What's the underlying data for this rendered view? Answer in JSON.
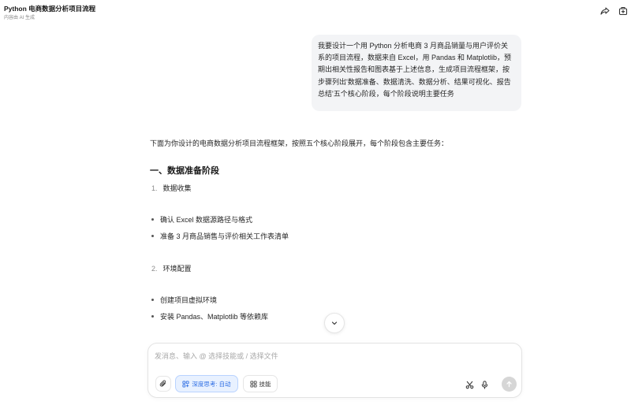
{
  "header": {
    "title": "Python 电商数据分析项目流程",
    "subtitle": "内容由 AI 生成"
  },
  "user_message": "我要设计一个用 Python 分析电商 3 月商品销量与用户评价关系的项目流程，数据来自 Excel，用 Pandas 和 Matplotlib，预期出相关性报告和图表基于上述信息，生成项目流程框架，按步骤列出'数据准备、数据清洗、数据分析、结果可视化、报告总结'五个核心阶段，每个阶段说明主要任务",
  "answer": {
    "intro": "下面为你设计的电商数据分析项目流程框架，按照五个核心阶段展开，每个阶段包含主要任务：",
    "section_title": "一、数据准备阶段",
    "steps": [
      {
        "number": "1.",
        "label": "数据收集",
        "bullets": [
          "确认 Excel 数据源路径与格式",
          "准备 3 月商品销售与评价相关工作表清单"
        ]
      },
      {
        "number": "2.",
        "label": "环境配置",
        "bullets": [
          "创建项目虚拟环境",
          "安装 Pandas、Matplotlib 等依赖库"
        ]
      }
    ]
  },
  "composer": {
    "placeholder": "发消息、输入 @ 选择技能或 / 选择文件",
    "deep_think_label": "深度思考: 自动",
    "skills_label": "技能"
  },
  "icons": {
    "share": "share-icon",
    "new_chat": "new-chat-icon",
    "scroll_down": "chevron-down-icon",
    "attach": "paperclip-icon",
    "deep_think": "deep-think-icon",
    "skills": "grid-icon",
    "scissors": "scissors-icon",
    "mic": "microphone-icon",
    "send": "arrow-up-icon"
  },
  "colors": {
    "accent": "#2f6fe4",
    "accent_bg": "#e8f1ff",
    "bubble_bg": "#f3f4f6",
    "send_disabled": "#d6d6d6"
  }
}
